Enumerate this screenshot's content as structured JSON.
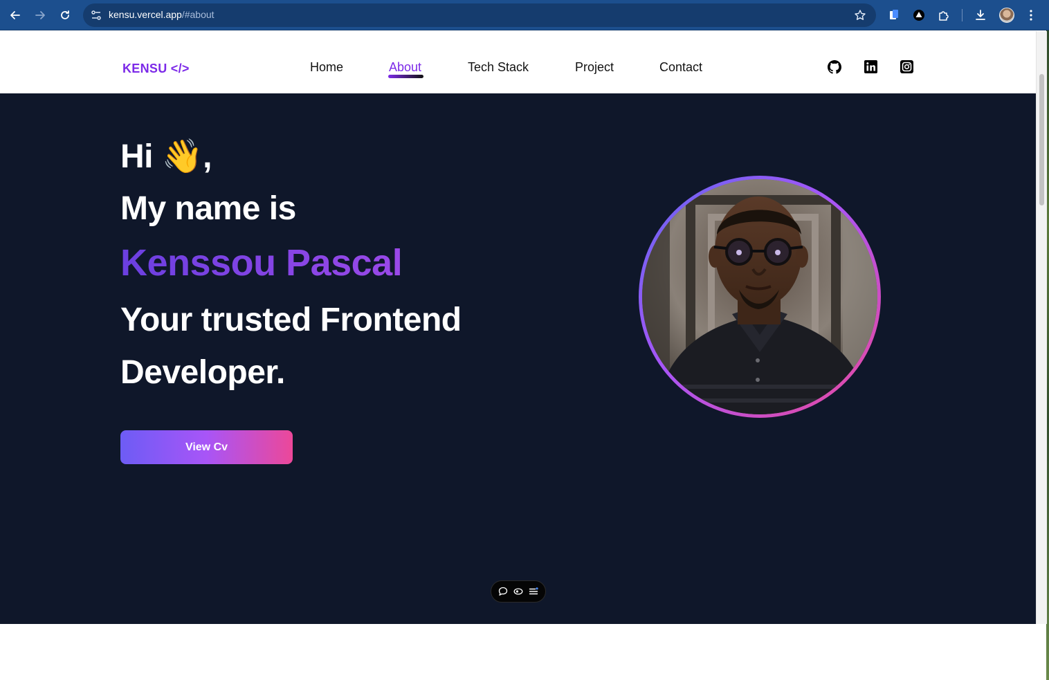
{
  "browser": {
    "url_host": "kensu.vercel.app",
    "url_path": "/#about",
    "icons": [
      "back-icon",
      "forward-icon",
      "reload-icon",
      "site-settings-icon",
      "bookmark-star-icon",
      "extension-icon",
      "extension-icon",
      "extensions-puzzle-icon",
      "download-icon",
      "profile-avatar",
      "more-menu-icon"
    ]
  },
  "nav": {
    "brand": "KENSU </>",
    "items": [
      {
        "label": "Home"
      },
      {
        "label": "About"
      },
      {
        "label": "Tech Stack"
      },
      {
        "label": "Project"
      },
      {
        "label": "Contact"
      }
    ],
    "active": "About",
    "social_icons": [
      "github-icon",
      "linkedin-icon",
      "instagram-icon"
    ]
  },
  "hero": {
    "greeting": "Hi 👋,",
    "intro": "My name is",
    "name": "Kenssou Pascal",
    "tagline_1": "Your trusted Frontend",
    "tagline_2": "Developer.",
    "cta": "View Cv"
  },
  "floating_toolbar": {
    "icons": [
      "comment-icon",
      "eye-icon",
      "menu-icon"
    ]
  },
  "colors": {
    "chrome": "#1c4f8e",
    "brand": "#7c2ae8",
    "hero_bg": "#0f172a",
    "gradient_start": "#6366f1",
    "gradient_mid": "#a855f7",
    "gradient_end": "#ec4899"
  }
}
